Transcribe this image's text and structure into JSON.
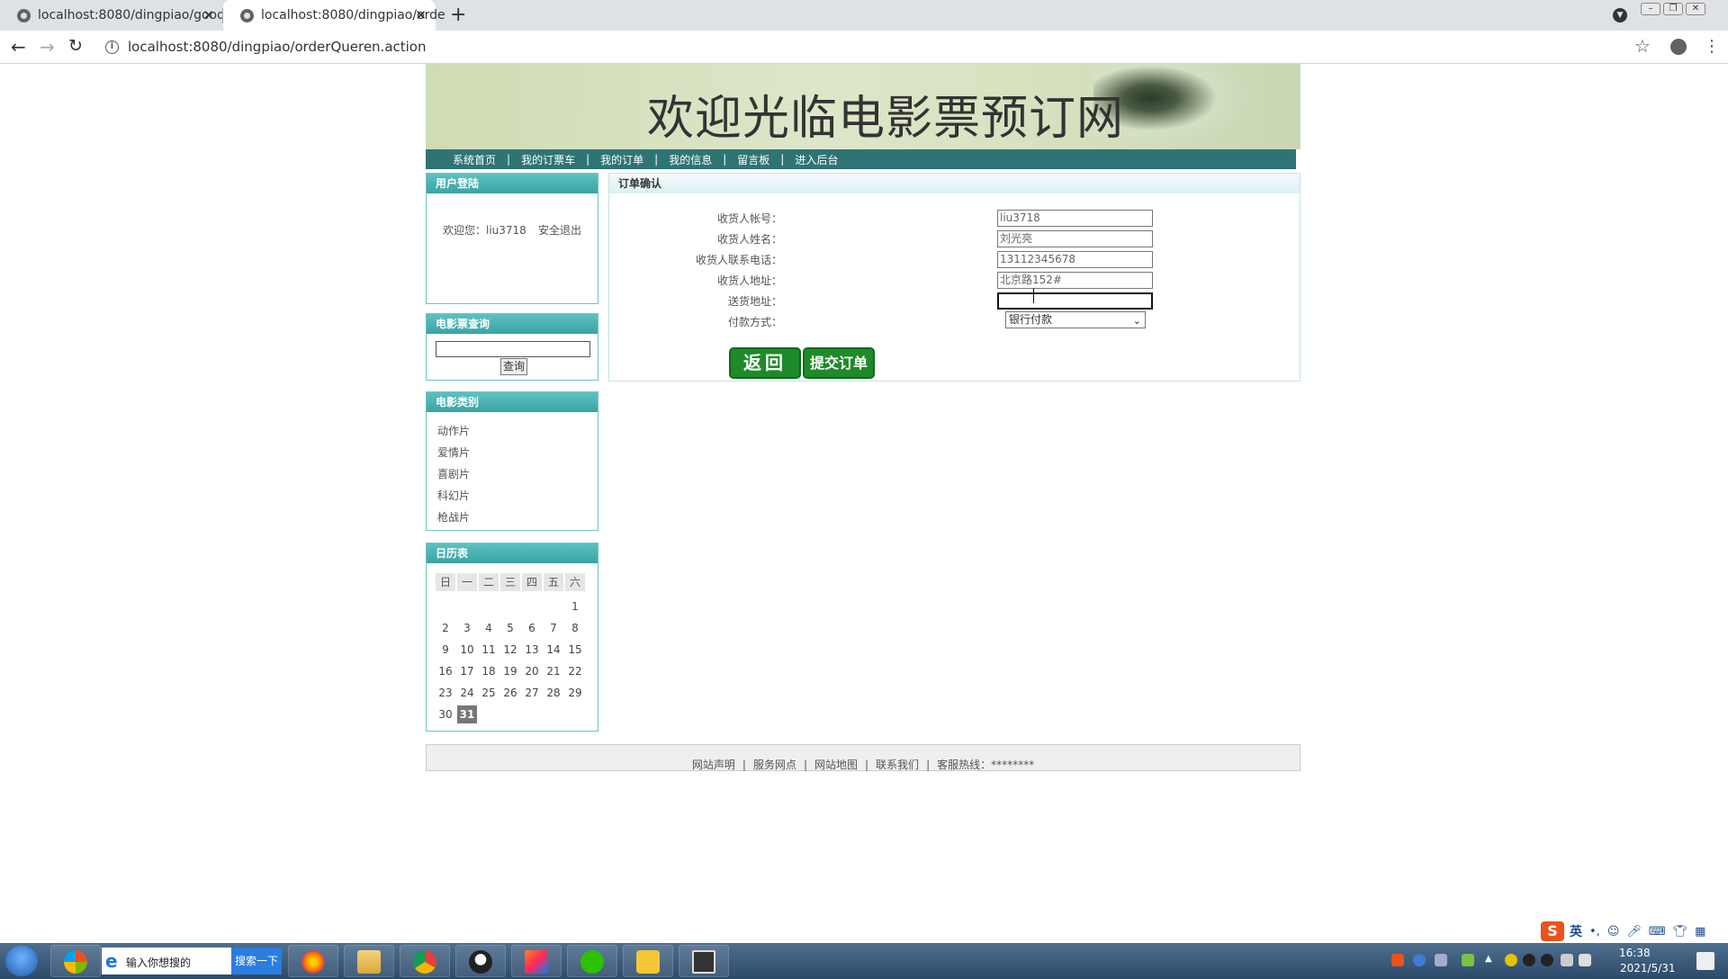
{
  "browser": {
    "tabs": [
      {
        "title": "localhost:8080/dingpiao/good",
        "active": false
      },
      {
        "title": "localhost:8080/dingpiao/orde",
        "active": true
      }
    ],
    "url": "localhost:8080/dingpiao/orderQueren.action"
  },
  "site": {
    "banner_title": "欢迎光临电影票预订网",
    "nav": [
      "系统首页",
      "我的订票车",
      "我的订单",
      "我的信息",
      "留言板",
      "进入后台"
    ],
    "nav_separator": "|"
  },
  "sidebar": {
    "login": {
      "title": "用户登陆",
      "welcome": "欢迎您：liu3718",
      "logout": "安全退出"
    },
    "search": {
      "title": "电影票查询",
      "input_value": "",
      "button": "查询"
    },
    "category": {
      "title": "电影类别",
      "items": [
        "动作片",
        "爱情片",
        "喜剧片",
        "科幻片",
        "枪战片"
      ]
    },
    "calendar": {
      "title": "日历表",
      "weekdays": [
        "日",
        "一",
        "二",
        "三",
        "四",
        "五",
        "六"
      ],
      "days": [
        "1",
        "2",
        "3",
        "4",
        "5",
        "6",
        "7",
        "8",
        "9",
        "10",
        "11",
        "12",
        "13",
        "14",
        "15",
        "16",
        "17",
        "18",
        "19",
        "20",
        "21",
        "22",
        "23",
        "24",
        "25",
        "26",
        "27",
        "28",
        "29",
        "30",
        "31"
      ],
      "first_weekday_index": 6,
      "today": "31"
    }
  },
  "order": {
    "title": "订单确认",
    "fields": [
      {
        "label": "收货人帐号：",
        "value": "liu3718"
      },
      {
        "label": "收货人姓名：",
        "value": "刘光亮"
      },
      {
        "label": "收货人联系电话：",
        "value": "13112345678"
      },
      {
        "label": "收货人地址：",
        "value": "北京路152#"
      },
      {
        "label": "送货地址：",
        "value": ""
      }
    ],
    "payment": {
      "label": "付款方式：",
      "selected": "银行付款"
    },
    "back_button": "返回",
    "submit_button": "提交订单"
  },
  "footer": {
    "links": [
      "网站声明",
      "服务网点",
      "网站地图",
      "联系我们"
    ],
    "hotline": "客服热线：********",
    "separator": "|"
  },
  "taskbar": {
    "search_placeholder": "输入你想搜的",
    "search_button": "搜索一下",
    "time": "16:38",
    "date": "2021/5/31",
    "ime_lang": "英",
    "apps": [
      "windows-logo-icon",
      "firefox-icon",
      "file-explorer-icon",
      "chrome-icon",
      "qq-app-icon",
      "intellij-icon",
      "wechat-icon",
      "folder-icon",
      "terminal-icon"
    ]
  },
  "colors": {
    "nav_bar": "#2f7474",
    "box_header": "#3aa3a3",
    "button_green": "#1f8a2a"
  }
}
